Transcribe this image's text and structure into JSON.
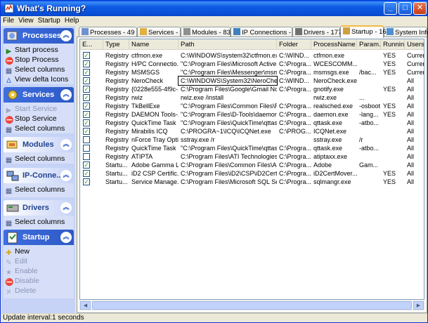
{
  "window": {
    "title": "What's Running?"
  },
  "menu": [
    "File",
    "View",
    "Startup",
    "Help"
  ],
  "sidebar": {
    "sections": [
      {
        "label": "Processes",
        "icon": "processes-icon",
        "tasks": [
          {
            "label": "Start process",
            "icon": "play-icon",
            "enabled": true
          },
          {
            "label": "Stop Process",
            "icon": "stop-icon",
            "enabled": true
          },
          {
            "label": "Select columns",
            "icon": "columns-icon",
            "enabled": true
          },
          {
            "label": "View delta Icons",
            "icon": "delta-icon",
            "enabled": true
          }
        ]
      },
      {
        "label": "Services",
        "icon": "services-icon",
        "tasks": [
          {
            "label": "Start Service",
            "icon": "play-icon",
            "enabled": false
          },
          {
            "label": "Stop Service",
            "icon": "stop-icon",
            "enabled": true
          },
          {
            "label": "Select columns",
            "icon": "columns-icon",
            "enabled": true
          }
        ]
      },
      {
        "label": "Modules",
        "icon": "modules-icon",
        "tasks": [
          {
            "label": "Select columns",
            "icon": "columns-icon",
            "enabled": true
          }
        ]
      },
      {
        "label": "IP-Conne...",
        "icon": "network-icon",
        "tasks": [
          {
            "label": "Select columns",
            "icon": "columns-icon",
            "enabled": true
          }
        ]
      },
      {
        "label": "Drivers",
        "icon": "drivers-icon",
        "tasks": [
          {
            "label": "Select columns",
            "icon": "columns-icon",
            "enabled": true
          }
        ]
      },
      {
        "label": "Startup",
        "icon": "startup-icon",
        "tasks": [
          {
            "label": "New",
            "icon": "new-icon",
            "enabled": true
          },
          {
            "label": "Edit",
            "icon": "edit-icon",
            "enabled": false
          },
          {
            "label": "Enable",
            "icon": "enable-icon",
            "enabled": false
          },
          {
            "label": "Disable",
            "icon": "disable-icon",
            "enabled": false
          },
          {
            "label": "Delete",
            "icon": "delete-icon",
            "enabled": false
          }
        ]
      }
    ]
  },
  "tabs": [
    {
      "label": "Processes - 49",
      "active": false
    },
    {
      "label": "Services - 100",
      "active": false
    },
    {
      "label": "Modules - 832",
      "active": false
    },
    {
      "label": "IP Connections - 55",
      "active": false
    },
    {
      "label": "Drivers - 177",
      "active": false
    },
    {
      "label": "Startup - 16",
      "active": true
    },
    {
      "label": "System Info",
      "active": false
    }
  ],
  "table": {
    "columns": [
      "E...",
      "Type",
      "Name",
      "Path",
      "Folder",
      "ProcessName",
      "Param...",
      "Running",
      "Users"
    ],
    "rows": [
      {
        "checked": true,
        "type": "Registry",
        "name": "ctfmon.exe",
        "path": "C:\\WINDOWS\\system32\\ctfmon.exe",
        "folder": "C:\\WIND...",
        "process": "ctfmon.exe",
        "param": "",
        "running": "YES",
        "users": "Current"
      },
      {
        "checked": true,
        "type": "Registry",
        "name": "H/PC Connectio...",
        "path": "\"C:\\Program Files\\Microsoft ActiveSy...",
        "folder": "C:\\Progra...",
        "process": "WCESCOMM....",
        "param": "",
        "running": "YES",
        "users": "Current"
      },
      {
        "checked": true,
        "type": "Registry",
        "name": "MSMSGS",
        "path": "\"C:\\Program Files\\Messenger\\msmsg...",
        "folder": "C:\\Progra...",
        "process": "msmsgs.exe",
        "param": "/bac...",
        "running": "YES",
        "users": "Current"
      },
      {
        "checked": true,
        "type": "Registry",
        "name": "NeroCheck",
        "path": "C:\\WINDOWS\\System32\\NeroCheck.exe",
        "folder": "C:\\WIND...",
        "process": "NeroCheck.exe",
        "param": "",
        "running": "",
        "users": "All",
        "selected": true
      },
      {
        "checked": true,
        "type": "Registry",
        "name": "{0228e555-4f9c-...",
        "path": "C:\\Program Files\\Google\\Gmail Notifi...",
        "folder": "C:\\Progra...",
        "process": "gnotify.exe",
        "param": "",
        "running": "YES",
        "users": "All"
      },
      {
        "checked": true,
        "type": "Registry",
        "name": "rwiz",
        "path": "rwiz.exe           /install",
        "folder": "",
        "process": "rwiz.exe",
        "param": "...",
        "running": "",
        "users": "All"
      },
      {
        "checked": true,
        "type": "Registry",
        "name": "TkBellExe",
        "path": "\"C:\\Program Files\\Common Files\\Rea...",
        "folder": "C:\\Progra...",
        "process": "realsched.exe",
        "param": "-osboot",
        "running": "YES",
        "users": "All"
      },
      {
        "checked": true,
        "type": "Registry",
        "name": "DAEMON Tools-...",
        "path": "\"C:\\Program Files\\D-Tools\\daemon.e...",
        "folder": "C:\\Progra...",
        "process": "daemon.exe",
        "param": "-lang...",
        "running": "YES",
        "users": "All"
      },
      {
        "checked": true,
        "type": "Registry",
        "name": "QuickTime Task",
        "path": "\"C:\\Program Files\\QuickTime\\qttask....",
        "folder": "C:\\Progra...",
        "process": "qttask.exe",
        "param": "-atbo...",
        "running": "",
        "users": "All"
      },
      {
        "checked": true,
        "type": "Registry",
        "name": "Mirabilis ICQ",
        "path": "C:\\PROGRA~1\\ICQ\\ICQNet.exe",
        "folder": "C:\\PROG...",
        "process": "ICQNet.exe",
        "param": "",
        "running": "",
        "users": "All"
      },
      {
        "checked": false,
        "type": "Registry",
        "name": "nForce Tray Opti...",
        "path": "sstray.exe  /r",
        "folder": "",
        "process": "sstray.exe",
        "param": "/r",
        "running": "",
        "users": "All"
      },
      {
        "checked": false,
        "type": "Registry",
        "name": "QuickTime Task",
        "path": "\"C:\\Program Files\\QuickTime\\qttask....",
        "folder": "C:\\Progra...",
        "process": "qttask.exe",
        "param": "-atbo...",
        "running": "",
        "users": "All"
      },
      {
        "checked": false,
        "type": "Registry",
        "name": "ATIPTA",
        "path": "C:\\Program Files\\ATI Technologies\\A...",
        "folder": "C:\\Progra...",
        "process": "atiptaxx.exe",
        "param": "",
        "running": "",
        "users": "All"
      },
      {
        "checked": true,
        "type": "Startu...",
        "name": "Adobe Gamma L...",
        "path": "C:\\Program Files\\Common Files\\Adob...",
        "folder": "C:\\Progra...",
        "process": "Adobe",
        "param": "Gam...",
        "running": "",
        "users": "All"
      },
      {
        "checked": true,
        "type": "Startu...",
        "name": "iD2 CSP Certific...",
        "path": "C:\\Program Files\\iD2\\CSP\\iD2CertM...",
        "folder": "C:\\Progra...",
        "process": "iD2CertMover....",
        "param": "",
        "running": "YES",
        "users": "All"
      },
      {
        "checked": true,
        "type": "Startu...",
        "name": "Service Manage...",
        "path": "C:\\Program Files\\Microsoft SQL Serv...",
        "folder": "C:\\Progra...",
        "process": "sqlmangr.exe",
        "param": "",
        "running": "YES",
        "users": "All"
      }
    ]
  },
  "status": {
    "text": "Update interval:1 seconds"
  }
}
